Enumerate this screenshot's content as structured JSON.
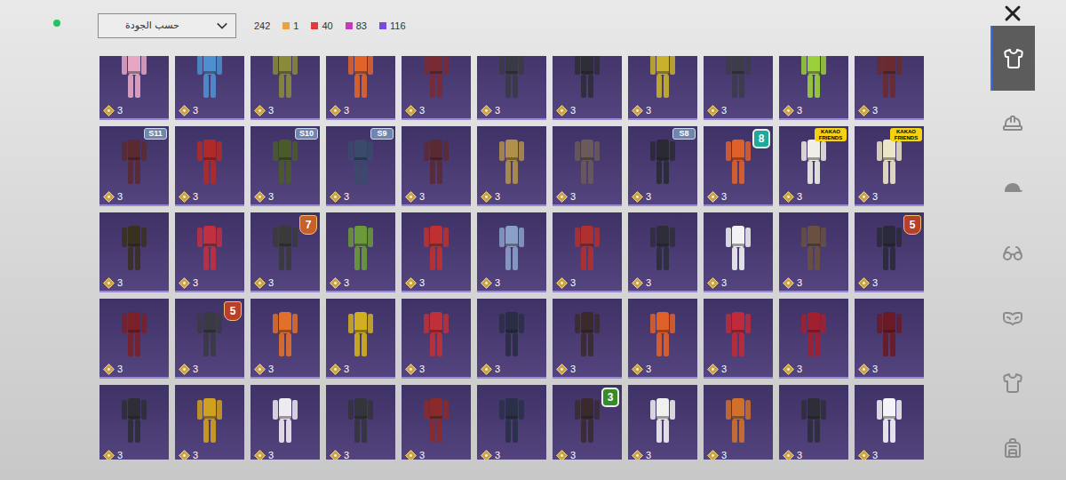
{
  "header": {
    "sort_label": "حسب الجودة",
    "total": "242",
    "counts": [
      {
        "value": "1",
        "color": "#e8a33a"
      },
      {
        "value": "40",
        "color": "#e03a3a"
      },
      {
        "value": "83",
        "color": "#c43ab8"
      },
      {
        "value": "116",
        "color": "#7a4ae0"
      }
    ]
  },
  "items": [
    {
      "quality": "3",
      "color": "#e7a6c4",
      "badge": null
    },
    {
      "quality": "3",
      "color": "#4f8fd0",
      "badge": null
    },
    {
      "quality": "3",
      "color": "#8a8a3a",
      "badge": null
    },
    {
      "quality": "3",
      "color": "#e0642a",
      "badge": null
    },
    {
      "quality": "3",
      "color": "#7a2a34",
      "badge": null
    },
    {
      "quality": "3",
      "color": "#3a3a44",
      "badge": null
    },
    {
      "quality": "3",
      "color": "#2e2e36",
      "badge": null
    },
    {
      "quality": "3",
      "color": "#c9b02a",
      "badge": null
    },
    {
      "quality": "3",
      "color": "#3c3c4a",
      "badge": null
    },
    {
      "quality": "3",
      "color": "#9ad03a",
      "badge": null
    },
    {
      "quality": "3",
      "color": "#6a2a30",
      "badge": null
    },
    {
      "quality": "3",
      "color": "#5a2a30",
      "badge": {
        "text": "S11",
        "kind": "season",
        "color": "#6f86b0"
      }
    },
    {
      "quality": "3",
      "color": "#b02a2a",
      "badge": null
    },
    {
      "quality": "3",
      "color": "#4a5a2a",
      "badge": {
        "text": "S10",
        "kind": "season",
        "color": "#6f86b0"
      }
    },
    {
      "quality": "3",
      "color": "#3a4a6a",
      "badge": {
        "text": "S9",
        "kind": "season",
        "color": "#6f86b0"
      }
    },
    {
      "quality": "3",
      "color": "#5a2a34",
      "badge": null
    },
    {
      "quality": "3",
      "color": "#b0904a",
      "badge": null
    },
    {
      "quality": "3",
      "color": "#6a5a5a",
      "badge": null
    },
    {
      "quality": "3",
      "color": "#2a2a34",
      "badge": {
        "text": "S8",
        "kind": "season",
        "color": "#6f86b0"
      }
    },
    {
      "quality": "3",
      "color": "#e0602a",
      "badge": {
        "text": "8",
        "kind": "hex",
        "color": "#1fa89b"
      }
    },
    {
      "quality": "3",
      "color": "#f0eee8",
      "badge": {
        "text": "KAKAO FRIENDS",
        "kind": "kakao",
        "color": "#f5d312"
      }
    },
    {
      "quality": "3",
      "color": "#ece6c8",
      "badge": {
        "text": "KAKAO FRIENDS",
        "kind": "kakao",
        "color": "#f5d312"
      }
    },
    {
      "quality": "3",
      "color": "#3a3020",
      "badge": null
    },
    {
      "quality": "3",
      "color": "#c03040",
      "badge": null
    },
    {
      "quality": "3",
      "color": "#3a3a3a",
      "badge": {
        "text": "7",
        "kind": "shield",
        "color": "#c8602a"
      }
    },
    {
      "quality": "3",
      "color": "#6a9a3a",
      "badge": null
    },
    {
      "quality": "3",
      "color": "#c03030",
      "badge": null
    },
    {
      "quality": "3",
      "color": "#8aa0c8",
      "badge": null
    },
    {
      "quality": "3",
      "color": "#b03030",
      "badge": null
    },
    {
      "quality": "3",
      "color": "#2e2e3a",
      "badge": null
    },
    {
      "quality": "3",
      "color": "#f2f2f2",
      "badge": null
    },
    {
      "quality": "3",
      "color": "#6a5040",
      "badge": null
    },
    {
      "quality": "3",
      "color": "#2a2a3a",
      "badge": {
        "text": "5",
        "kind": "shield",
        "color": "#b8402a"
      }
    },
    {
      "quality": "3",
      "color": "#7a2028",
      "badge": null
    },
    {
      "quality": "3",
      "color": "#3a3a44",
      "badge": {
        "text": "5",
        "kind": "shield",
        "color": "#b8402a"
      }
    },
    {
      "quality": "3",
      "color": "#e0702a",
      "badge": null
    },
    {
      "quality": "3",
      "color": "#d0b020",
      "badge": null
    },
    {
      "quality": "3",
      "color": "#c03038",
      "badge": null
    },
    {
      "quality": "3",
      "color": "#2a2e44",
      "badge": null
    },
    {
      "quality": "3",
      "color": "#3a2a2e",
      "badge": null
    },
    {
      "quality": "3",
      "color": "#e0602a",
      "badge": null
    },
    {
      "quality": "3",
      "color": "#c02a3a",
      "badge": null
    },
    {
      "quality": "3",
      "color": "#a02030",
      "badge": null
    },
    {
      "quality": "3",
      "color": "#6a1a24",
      "badge": null
    },
    {
      "quality": "3",
      "color": "#2e2e36",
      "badge": null
    },
    {
      "quality": "3",
      "color": "#d0a020",
      "badge": null
    },
    {
      "quality": "3",
      "color": "#eeeaf2",
      "badge": null
    },
    {
      "quality": "3",
      "color": "#34343c",
      "badge": null
    },
    {
      "quality": "3",
      "color": "#8a2a2a",
      "badge": null
    },
    {
      "quality": "3",
      "color": "#2a3048",
      "badge": null
    },
    {
      "quality": "3",
      "color": "#3a2a30",
      "badge": {
        "text": "3",
        "kind": "hex",
        "color": "#3a8a2a"
      }
    },
    {
      "quality": "3",
      "color": "#f0f0f0",
      "badge": null
    },
    {
      "quality": "3",
      "color": "#d0702a",
      "badge": null
    },
    {
      "quality": "3",
      "color": "#2e2e3a",
      "badge": null
    },
    {
      "quality": "3",
      "color": "#f4f4f8",
      "badge": null
    }
  ],
  "sidebar": {
    "tabs": [
      {
        "kind": "outfit",
        "selected": true
      },
      {
        "kind": "helmet",
        "selected": false
      },
      {
        "kind": "cap",
        "selected": false
      },
      {
        "kind": "glasses",
        "selected": false
      },
      {
        "kind": "mask",
        "selected": false
      },
      {
        "kind": "jacket",
        "selected": false
      },
      {
        "kind": "backpack",
        "selected": false
      }
    ]
  }
}
